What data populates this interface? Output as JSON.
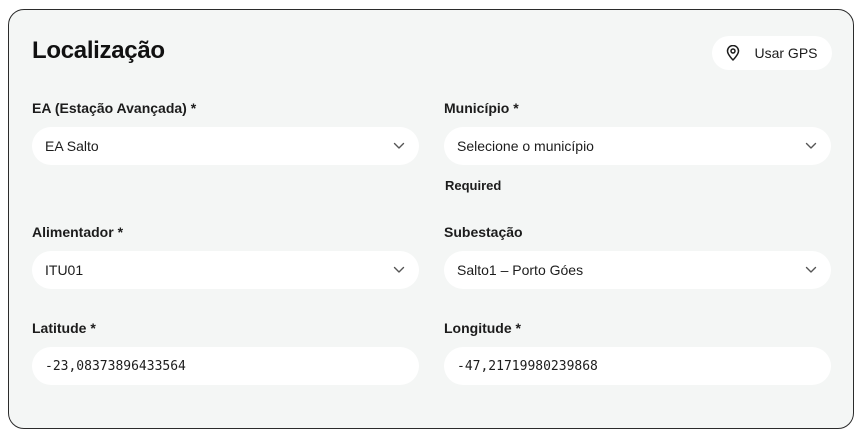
{
  "section": {
    "title": "Localização",
    "gps_button_label": "Usar GPS"
  },
  "fields": {
    "ea": {
      "label": "EA (Estação Avançada) *",
      "value": "EA Salto"
    },
    "municipio": {
      "label": "Município *",
      "placeholder": "Selecione o município",
      "helper": "Required"
    },
    "alimentador": {
      "label": "Alimentador *",
      "value": "ITU01"
    },
    "subestacao": {
      "label": "Subestação",
      "value": "Salto1 – Porto Góes"
    },
    "latitude": {
      "label": "Latitude *",
      "value": "-23,08373896433564"
    },
    "longitude": {
      "label": "Longitude *",
      "value": "-47,21719980239868"
    }
  },
  "icons": {
    "gps": "map-pin-icon",
    "dropdown": "chevron-down-icon"
  }
}
